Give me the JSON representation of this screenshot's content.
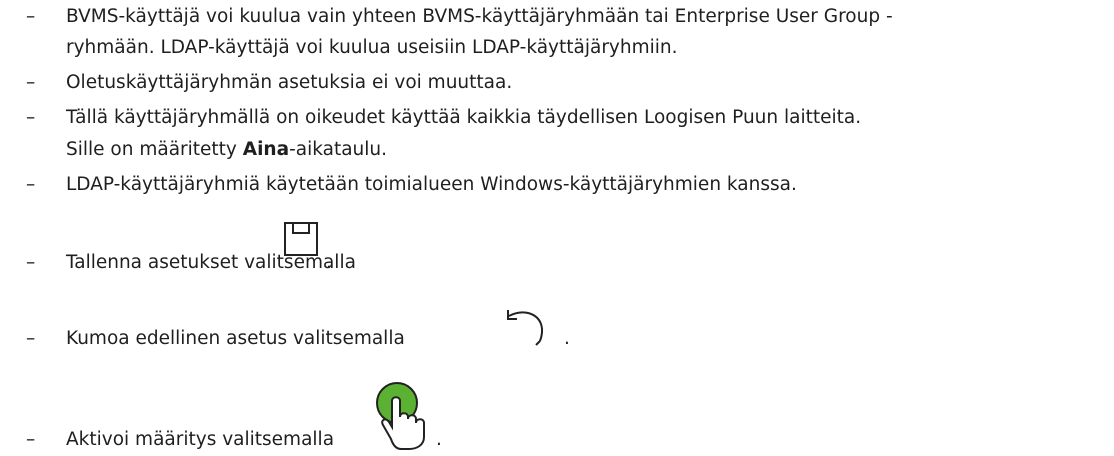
{
  "bullet": "–",
  "items": [
    {
      "line1": "BVMS-käyttäjä voi kuulua vain yhteen BVMS-käyttäjäryhmään tai Enterprise User Group -",
      "line2": "ryhmään. LDAP-käyttäjä voi kuulua useisiin LDAP-käyttäjäryhmiin."
    },
    {
      "line1": "Oletuskäyttäjäryhmän asetuksia ei voi muuttaa."
    },
    {
      "line1": "Tällä käyttäjäryhmällä on oikeudet käyttää kaikkia täydellisen Loogisen Puun laitteita.",
      "line2_before": "Sille on määritetty ",
      "line2_bold": "Aina",
      "line2_after": "-aikataulu."
    },
    {
      "line1": "LDAP-käyttäjäryhmiä käytetään toimialueen Windows-käyttäjäryhmien kanssa."
    },
    {
      "text": "Tallenna asetukset valitsemalla",
      "icon": "save-icon",
      "end": "."
    },
    {
      "text": "Kumoa edellinen asetus valitsemalla",
      "icon": "undo-icon",
      "end": "."
    },
    {
      "text": "Aktivoi määritys valitsemalla",
      "icon": "activate-hand-icon",
      "icon_color": "#5bb131",
      "end": "."
    }
  ]
}
